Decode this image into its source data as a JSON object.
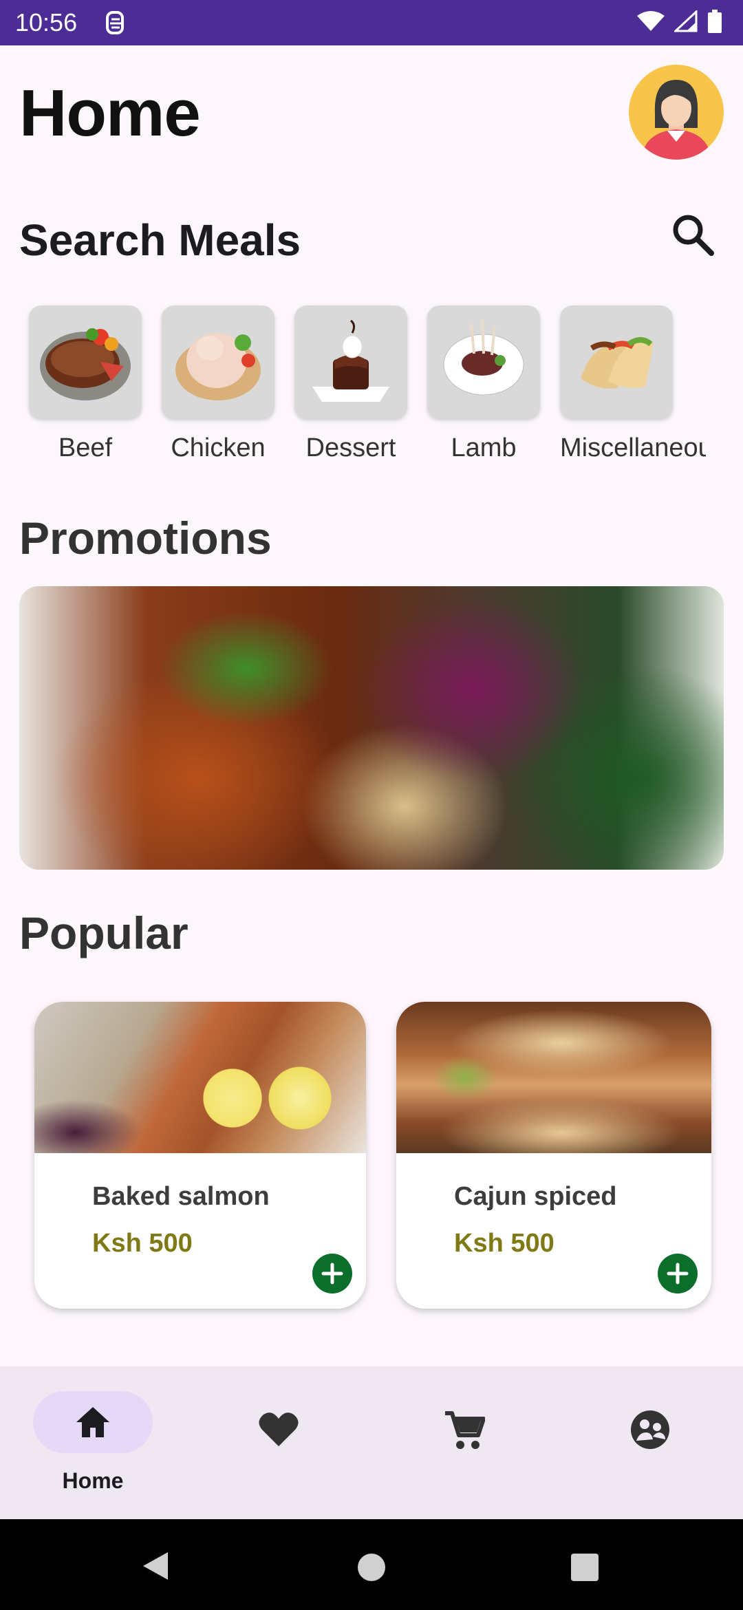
{
  "status_bar": {
    "time": "10:56"
  },
  "header": {
    "title": "Home"
  },
  "search_section": {
    "title": "Search Meals"
  },
  "categories": [
    {
      "label": "Beef"
    },
    {
      "label": "Chicken"
    },
    {
      "label": "Dessert"
    },
    {
      "label": "Lamb"
    },
    {
      "label": "Miscellaneous"
    }
  ],
  "promotions": {
    "title": "Promotions"
  },
  "popular": {
    "title": "Popular",
    "items": [
      {
        "name": "Baked salmon",
        "price": "Ksh 500"
      },
      {
        "name": "Cajun spiced",
        "price": "Ksh 500"
      }
    ]
  },
  "bottom_nav": {
    "items": [
      {
        "icon": "home-icon",
        "label": "Home",
        "selected": true
      },
      {
        "icon": "heart-icon",
        "label": "",
        "selected": false
      },
      {
        "icon": "cart-icon",
        "label": "",
        "selected": false
      },
      {
        "icon": "profile-icon",
        "label": "",
        "selected": false
      }
    ]
  },
  "colors": {
    "status_bar": "#4b2d95",
    "background": "#fdf7fc",
    "price": "#807a16",
    "add_button": "#0b6e2b",
    "nav_bg": "#efe8f3",
    "nav_pill": "#e5d9f7"
  }
}
